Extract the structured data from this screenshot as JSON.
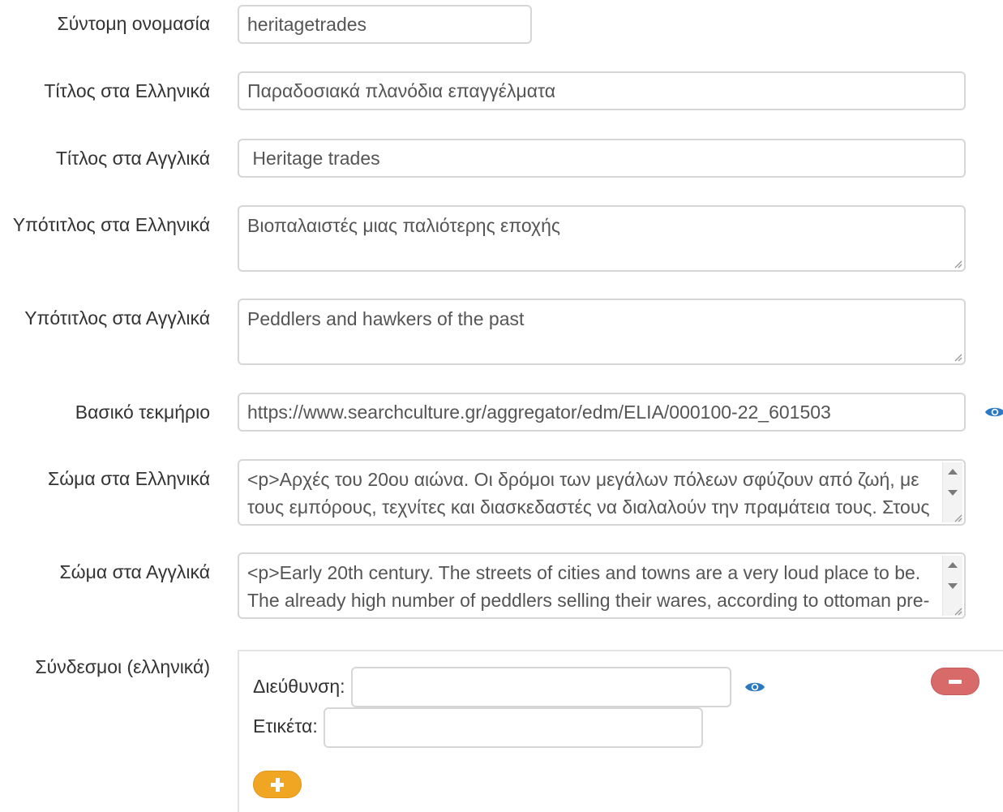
{
  "form": {
    "short_name": {
      "label": "Σύντομη ονομασία",
      "value": "heritagetrades"
    },
    "title_el": {
      "label": "Τίτλος στα Ελληνικά",
      "value": "Παραδοσιακά πλανόδια επαγγέλματα"
    },
    "title_en": {
      "label": "Τίτλος στα Αγγλικά",
      "value": " Heritage trades"
    },
    "subtitle_el": {
      "label": "Υπότιτλος στα Ελληνικά",
      "value": "Βιοπαλαιστές μιας παλιότερης εποχής"
    },
    "subtitle_en": {
      "label": "Υπότιτλος στα Αγγλικά",
      "value": "Peddlers and hawkers of the past"
    },
    "main_item": {
      "label": "Βασικό τεκμήριο",
      "value": "https://www.searchculture.gr/aggregator/edm/ELIA/000100-22_601503"
    },
    "body_el": {
      "label": "Σώμα στα Ελληνικά",
      "value": "<p>Αρχές του 20ου αιώνα. Οι δρόμοι των μεγάλων πόλεων σφύζουν από ζωή, με\nτους εμπόρους, τεχνίτες και διασκεδαστές να διαλαλούν την πραμάτεια τους. Στους"
    },
    "body_en": {
      "label": "Σώμα στα Αγγλικά",
      "value": "<p>Early 20th century. The streets of cities and towns are a very loud place to be.\nThe already high number of peddlers selling their wares, according to ottoman pre-"
    },
    "links_el": {
      "label": "Σύνδεσμοι (ελληνικά)",
      "address_label": "Διεύθυνση:",
      "address_value": "",
      "tag_label": "Ετικέτα:",
      "tag_value": ""
    }
  },
  "icons": {
    "preview": "eye-icon",
    "remove": "minus-icon",
    "add": "plus-icon"
  },
  "colors": {
    "eye": "#2b78c5",
    "remove_button": "#d96a6a",
    "add_button": "#f0a623"
  }
}
